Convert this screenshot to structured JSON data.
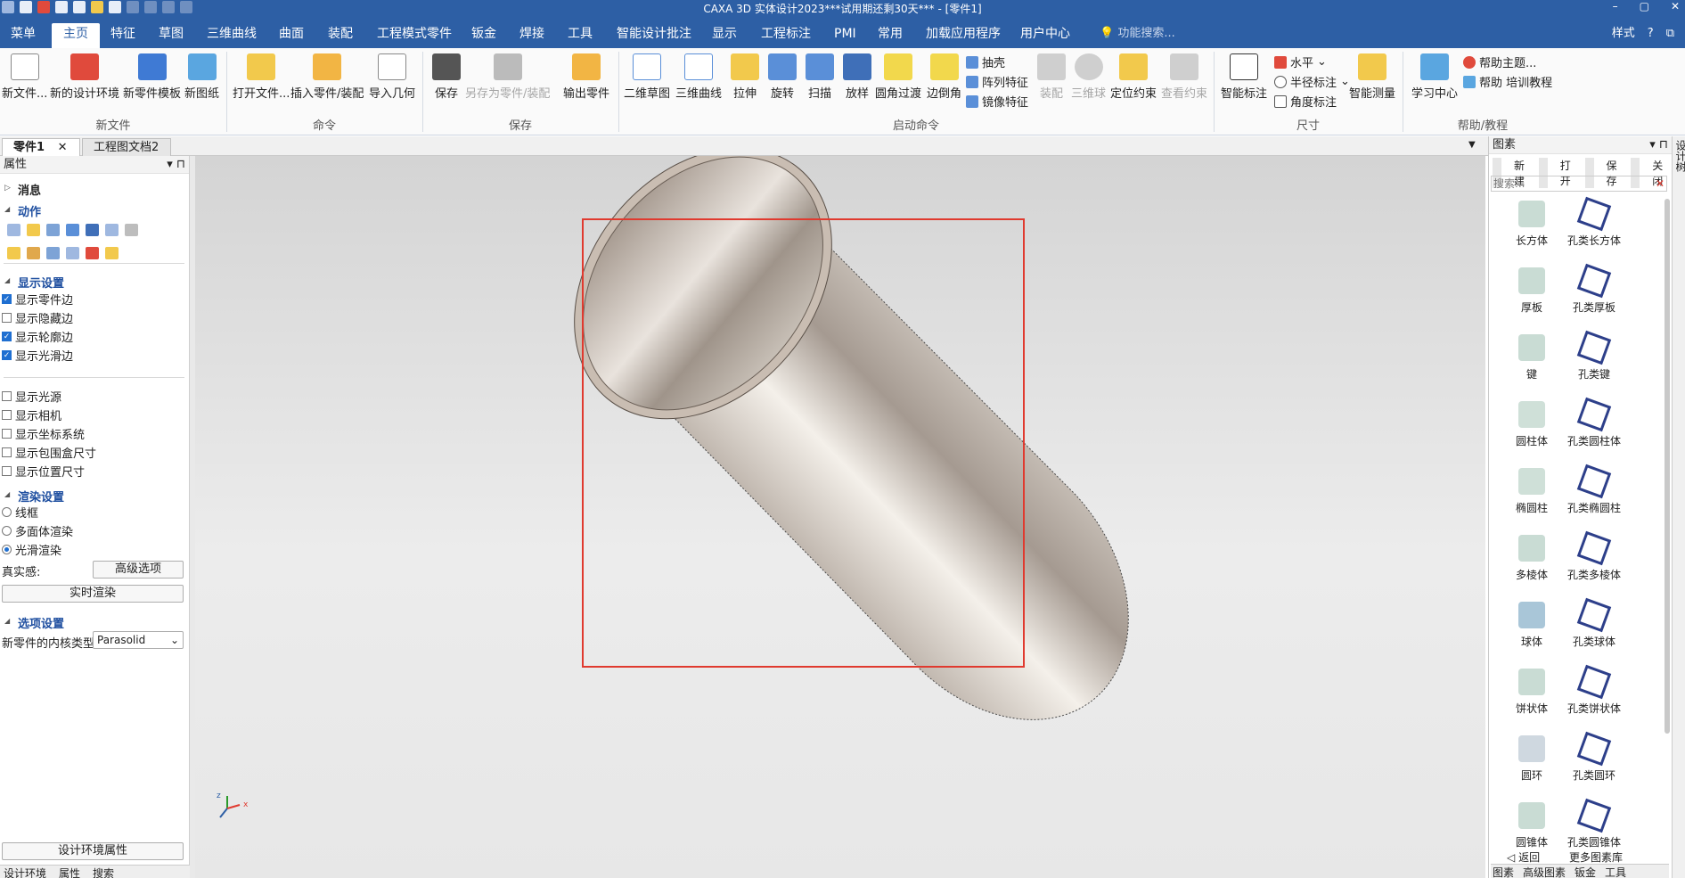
{
  "titlebar": {
    "title": "CAXA 3D 实体设计2023***试用期还剩30天*** - [零件1]"
  },
  "tabs": [
    "菜单",
    "主页",
    "特征",
    "草图",
    "三维曲线",
    "曲面",
    "装配",
    "工程模式零件",
    "钣金",
    "焊接",
    "工具",
    "智能设计批注",
    "显示",
    "工程标注",
    "PMI",
    "常用",
    "加载应用程序",
    "用户中心"
  ],
  "tab_search": "功能搜索...",
  "tab_right": {
    "style": "样式",
    "help": "?"
  },
  "ribbon": {
    "new_file": {
      "btn1": "新文件...",
      "btn2": "新的设计环境",
      "btn3": "新零件模板",
      "btn4": "新图纸",
      "group": "新文件"
    },
    "command": {
      "btn1": "打开文件...",
      "btn2": "插入零件/装配",
      "btn3": "导入几何",
      "group": "命令"
    },
    "save": {
      "btn1": "保存",
      "btn2": "另存为零件/装配",
      "btn3": "输出零件",
      "group": "保存"
    },
    "launch": {
      "btn1": "二维草图",
      "btn2": "三维曲线",
      "btn3": "拉伸",
      "btn4": "旋转",
      "btn5": "扫描",
      "btn6": "放样",
      "btn7": "圆角过渡",
      "btn8": "边倒角",
      "s1": "抽壳",
      "s2": "阵列特征",
      "s3": "镜像特征",
      "btn9": "装配",
      "btn10": "三维球",
      "btn11": "定位约束",
      "btn12": "查看约束",
      "group": "启动命令"
    },
    "dimension": {
      "btn1": "智能标注",
      "s1": "水平",
      "s2": "半径标注",
      "s3": "角度标注",
      "btn2": "智能测量",
      "group": "尺寸"
    },
    "help": {
      "btn1": "学习中心",
      "s1": "帮助主题...",
      "s2": "帮助 培训教程",
      "group": "帮助/教程"
    }
  },
  "doc_tabs": [
    "零件1",
    "工程图文档2"
  ],
  "left_panel": {
    "header": "属性",
    "messages": "消息",
    "actions": "动作",
    "display_settings": "显示设置",
    "display_checks": [
      {
        "label": "显示零件边",
        "checked": true
      },
      {
        "label": "显示隐藏边",
        "checked": false
      },
      {
        "label": "显示轮廓边",
        "checked": true
      },
      {
        "label": "显示光滑边",
        "checked": true
      }
    ],
    "display_checks2": [
      {
        "label": "显示光源",
        "checked": false
      },
      {
        "label": "显示相机",
        "checked": false
      },
      {
        "label": "显示坐标系统",
        "checked": false
      },
      {
        "label": "显示包围盒尺寸",
        "checked": false
      },
      {
        "label": "显示位置尺寸",
        "checked": false
      }
    ],
    "render_settings": "渲染设置",
    "render_options": [
      {
        "label": "线框",
        "selected": false
      },
      {
        "label": "多面体渲染",
        "selected": false
      },
      {
        "label": "光滑渲染",
        "selected": true
      }
    ],
    "realism_label": "真实感:",
    "advanced_btn": "高级选项",
    "realtime_btn": "实时渲染",
    "option_settings": "选项设置",
    "kernel_label": "新零件的内核类型",
    "kernel_value": "Parasolid",
    "env_props_btn": "设计环境属性",
    "bottom_tabs": [
      "设计环境",
      "属性",
      "搜索"
    ]
  },
  "right_panel": {
    "header": "图素",
    "buttons": [
      "新建",
      "打开",
      "保存",
      "关闭"
    ],
    "search_placeholder": "搜索...",
    "items": [
      [
        "长方体",
        "孔类长方体"
      ],
      [
        "厚板",
        "孔类厚板"
      ],
      [
        "键",
        "孔类键"
      ],
      [
        "圆柱体",
        "孔类圆柱体"
      ],
      [
        "椭圆柱",
        "孔类椭圆柱"
      ],
      [
        "多棱体",
        "孔类多棱体"
      ],
      [
        "球体",
        "孔类球体"
      ],
      [
        "饼状体",
        "孔类饼状体"
      ],
      [
        "圆环",
        "孔类圆环"
      ],
      [
        "圆锥体",
        "孔类圆锥体"
      ]
    ],
    "back": "返回",
    "more": "更多图素库",
    "bottom_tabs": [
      "图素",
      "高级图素",
      "钣金",
      "工具"
    ],
    "side_label": "设计树"
  },
  "colors": {
    "accent": "#2d5fa5",
    "selection": "#e03a2f"
  }
}
